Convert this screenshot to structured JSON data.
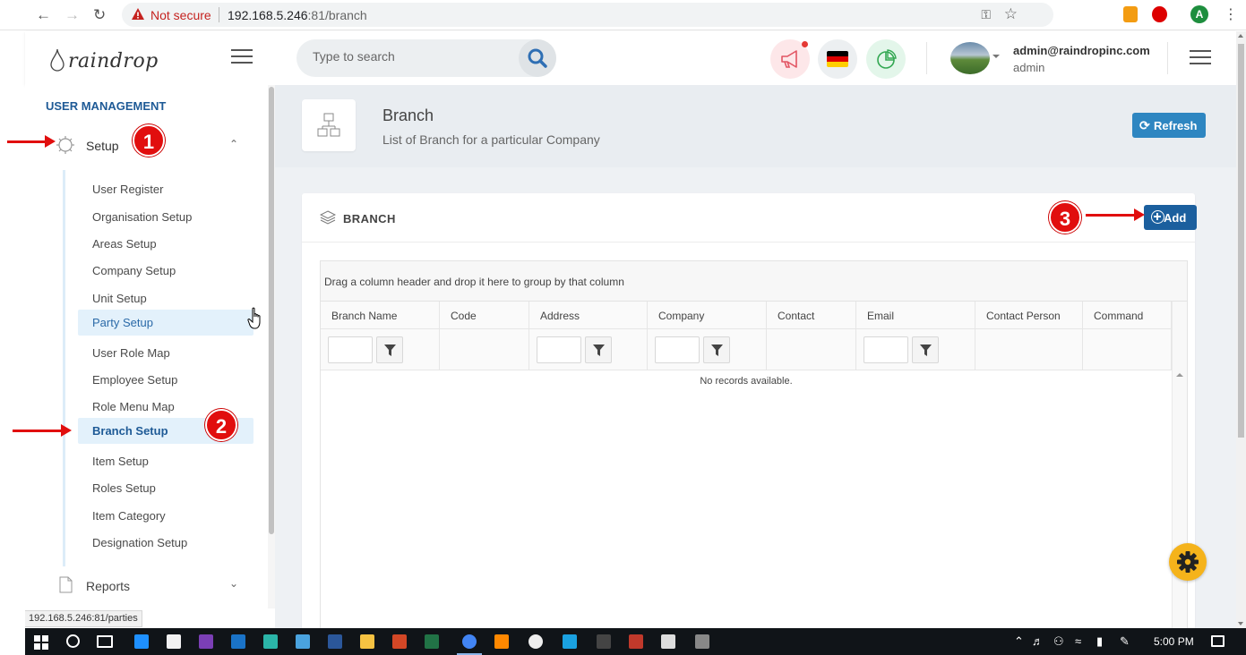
{
  "browser": {
    "security_label": "Not secure",
    "url_host": "192.168.5.246",
    "url_rest": ":81/branch",
    "profile_initial": "A"
  },
  "header": {
    "logo_text": "raindrop",
    "search_placeholder": "Type to search",
    "user_email": "admin@raindropinc.com",
    "user_role": "admin"
  },
  "sidebar": {
    "section_title": "USER MANAGEMENT",
    "setup_label": "Setup",
    "items": [
      {
        "label": "User Register"
      },
      {
        "label": "Organisation Setup"
      },
      {
        "label": "Areas Setup"
      },
      {
        "label": "Company Setup"
      },
      {
        "label": "Unit Setup"
      },
      {
        "label": "Party Setup"
      },
      {
        "label": "User Role Map"
      },
      {
        "label": "Employee Setup"
      },
      {
        "label": "Role Menu Map"
      },
      {
        "label": "Branch Setup"
      },
      {
        "label": "Item Setup"
      },
      {
        "label": "Roles Setup"
      },
      {
        "label": "Item Category"
      },
      {
        "label": "Designation Setup"
      }
    ],
    "reports_label": "Reports",
    "hover_item": "Party Setup",
    "active_item": "Branch Setup"
  },
  "status_bar_url": "192.168.5.246:81/parties",
  "page": {
    "title": "Branch",
    "subtitle": "List of Branch for a particular Company",
    "refresh_label": "Refresh"
  },
  "card": {
    "title": "BRANCH",
    "add_label": "Add"
  },
  "grid": {
    "group_hint": "Drag a column header and drop it here to group by that column",
    "columns": [
      {
        "label": "Branch Name",
        "filterable": true
      },
      {
        "label": "Code",
        "filterable": false
      },
      {
        "label": "Address",
        "filterable": true
      },
      {
        "label": "Company",
        "filterable": true
      },
      {
        "label": "Contact",
        "filterable": false
      },
      {
        "label": "Email",
        "filterable": true
      },
      {
        "label": "Contact Person",
        "filterable": false
      },
      {
        "label": "Command",
        "filterable": false
      }
    ],
    "empty_text": "No records available."
  },
  "annotations": [
    "1",
    "2",
    "3"
  ],
  "taskbar": {
    "clock": "5:00 PM"
  },
  "colors": {
    "brand_primary": "#1b5f9e",
    "refresh_blue": "#2e86c1",
    "annotation_red": "#e10e0e",
    "fab_yellow": "#f5b31b",
    "sidebar_highlight": "#e3f1fb"
  }
}
